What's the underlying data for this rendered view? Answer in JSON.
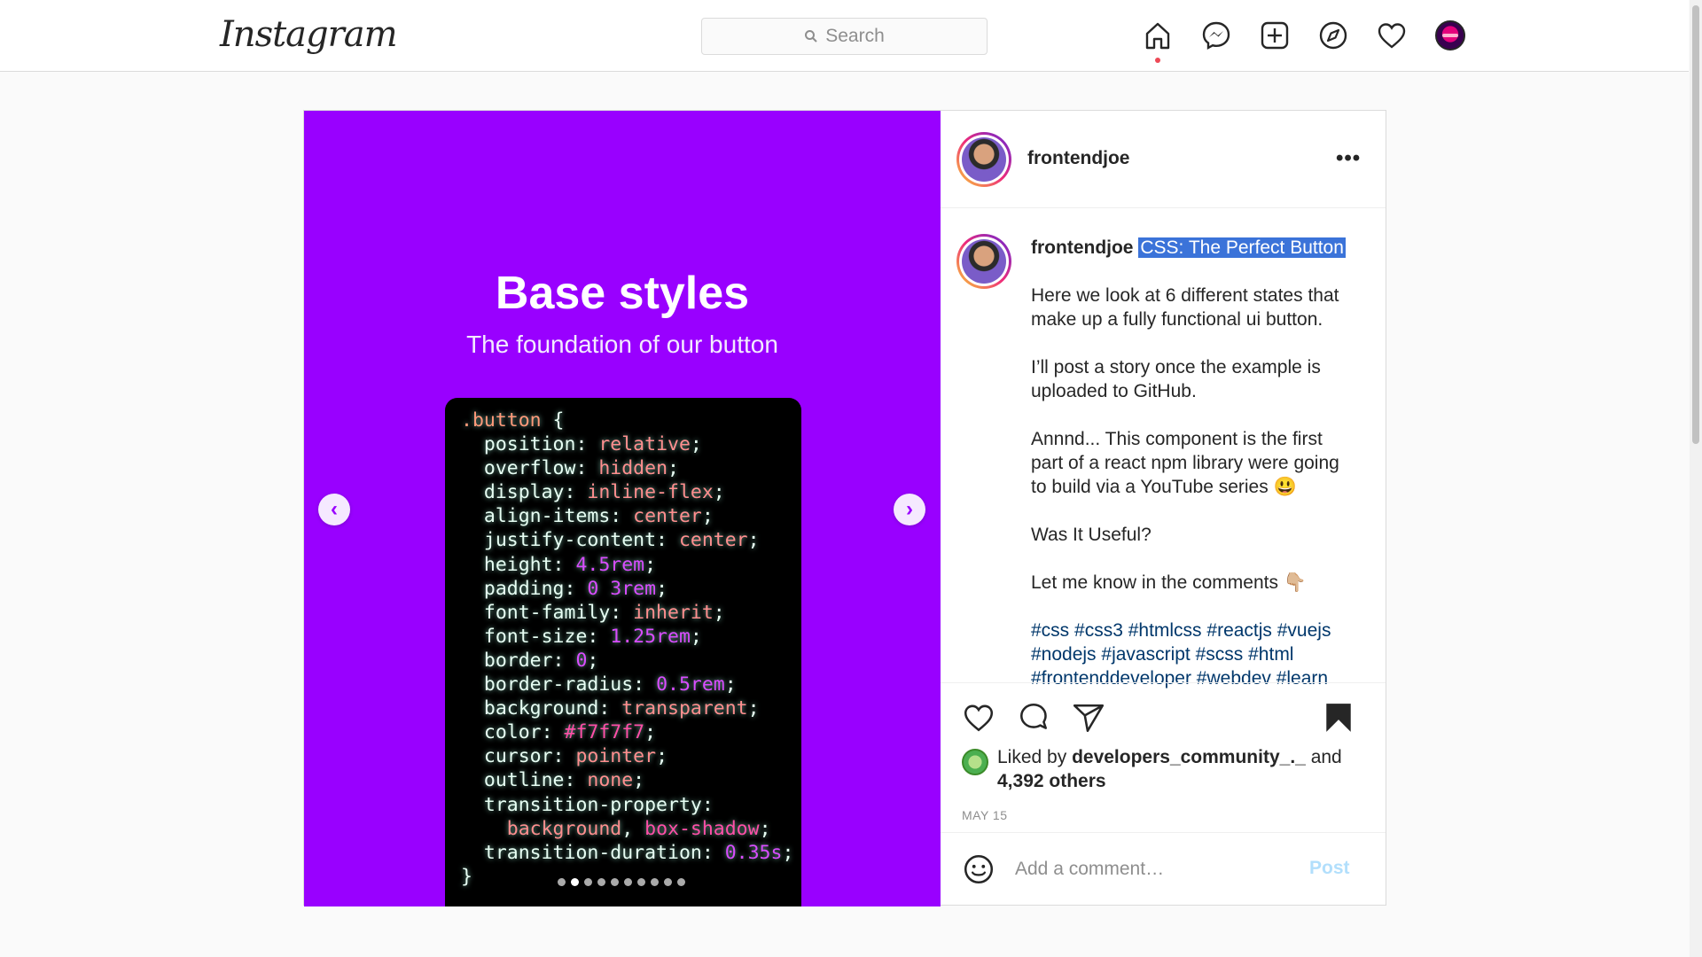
{
  "header": {
    "logo": "Instagram",
    "search_placeholder": "Search",
    "nav": [
      "home-icon",
      "messenger-icon",
      "new-post-icon",
      "explore-icon",
      "activity-heart-icon",
      "profile-avatar"
    ]
  },
  "post": {
    "slide": {
      "title": "Base styles",
      "subtitle": "The foundation of our button",
      "code": [
        {
          "indent": "",
          "parts": [
            {
              "c": "sel",
              "t": ".button"
            },
            {
              "c": "",
              "t": " {"
            }
          ]
        },
        {
          "indent": "  ",
          "parts": [
            {
              "c": "",
              "t": "position: "
            },
            {
              "c": "val",
              "t": "relative"
            },
            {
              "c": "",
              "t": ";"
            }
          ]
        },
        {
          "indent": "  ",
          "parts": [
            {
              "c": "",
              "t": "overflow: "
            },
            {
              "c": "val",
              "t": "hidden"
            },
            {
              "c": "",
              "t": ";"
            }
          ]
        },
        {
          "indent": "  ",
          "parts": [
            {
              "c": "",
              "t": "display: "
            },
            {
              "c": "val",
              "t": "inline-flex"
            },
            {
              "c": "",
              "t": ";"
            }
          ]
        },
        {
          "indent": "  ",
          "parts": [
            {
              "c": "",
              "t": "align-items: "
            },
            {
              "c": "val",
              "t": "center"
            },
            {
              "c": "",
              "t": ";"
            }
          ]
        },
        {
          "indent": "  ",
          "parts": [
            {
              "c": "",
              "t": "justify-content: "
            },
            {
              "c": "val",
              "t": "center"
            },
            {
              "c": "",
              "t": ";"
            }
          ]
        },
        {
          "indent": "  ",
          "parts": [
            {
              "c": "",
              "t": "height: "
            },
            {
              "c": "num",
              "t": "4.5rem"
            },
            {
              "c": "",
              "t": ";"
            }
          ]
        },
        {
          "indent": "  ",
          "parts": [
            {
              "c": "",
              "t": "padding: "
            },
            {
              "c": "num",
              "t": "0 3rem"
            },
            {
              "c": "",
              "t": ";"
            }
          ]
        },
        {
          "indent": "  ",
          "parts": [
            {
              "c": "",
              "t": "font-family: "
            },
            {
              "c": "val",
              "t": "inherit"
            },
            {
              "c": "",
              "t": ";"
            }
          ]
        },
        {
          "indent": "  ",
          "parts": [
            {
              "c": "",
              "t": "font-size: "
            },
            {
              "c": "num",
              "t": "1.25rem"
            },
            {
              "c": "",
              "t": ";"
            }
          ]
        },
        {
          "indent": "  ",
          "parts": [
            {
              "c": "",
              "t": "border: "
            },
            {
              "c": "num",
              "t": "0"
            },
            {
              "c": "",
              "t": ";"
            }
          ]
        },
        {
          "indent": "  ",
          "parts": [
            {
              "c": "",
              "t": "border-radius: "
            },
            {
              "c": "num",
              "t": "0.5rem"
            },
            {
              "c": "",
              "t": ";"
            }
          ]
        },
        {
          "indent": "  ",
          "parts": [
            {
              "c": "",
              "t": "background: "
            },
            {
              "c": "val",
              "t": "transparent"
            },
            {
              "c": "",
              "t": ";"
            }
          ]
        },
        {
          "indent": "  ",
          "parts": [
            {
              "c": "",
              "t": "color: "
            },
            {
              "c": "pk",
              "t": "#f7f7f7"
            },
            {
              "c": "",
              "t": ";"
            }
          ]
        },
        {
          "indent": "  ",
          "parts": [
            {
              "c": "",
              "t": "cursor: "
            },
            {
              "c": "val",
              "t": "pointer"
            },
            {
              "c": "",
              "t": ";"
            }
          ]
        },
        {
          "indent": "  ",
          "parts": [
            {
              "c": "",
              "t": "outline: "
            },
            {
              "c": "val",
              "t": "none"
            },
            {
              "c": "",
              "t": ";"
            }
          ]
        },
        {
          "indent": "  ",
          "parts": [
            {
              "c": "",
              "t": "transition-property:"
            }
          ]
        },
        {
          "indent": "    ",
          "parts": [
            {
              "c": "val",
              "t": "background"
            },
            {
              "c": "",
              "t": ", "
            },
            {
              "c": "pk",
              "t": "box-shadow"
            },
            {
              "c": "",
              "t": ";"
            }
          ]
        },
        {
          "indent": "  ",
          "parts": [
            {
              "c": "",
              "t": "transition-duration: "
            },
            {
              "c": "num",
              "t": "0.35s"
            },
            {
              "c": "",
              "t": ";"
            }
          ]
        },
        {
          "indent": "",
          "parts": [
            {
              "c": "",
              "t": "}"
            }
          ]
        }
      ],
      "dots_total": 10,
      "dots_active_index": 1,
      "bg_color": "#9900ff"
    },
    "author": "frontendjoe",
    "more_label": "•••",
    "caption": {
      "username": "frontendjoe",
      "title": "CSS: The Perfect Button",
      "paragraphs": [
        "Here we look at 6 different states that make up a fully functional ui button.",
        "I’ll post a story once the example is uploaded to GitHub.",
        "Annnd... This component is the first part of a react npm library were going to build via a YouTube series 😃",
        "Was It Useful?",
        "Let me know in the comments 👇🏼"
      ],
      "hashtags": "#css #css3 #htmlcss #reactjs #vuejs #nodejs #javascript #scss #html #frontenddeveloper #webdev #learn"
    },
    "likes": {
      "prefix": "Liked by",
      "user": "developers_community_._",
      "and": "and",
      "others": "4,392 others"
    },
    "date": "MAY 15",
    "comment": {
      "placeholder": "Add a comment…",
      "post_label": "Post"
    }
  }
}
